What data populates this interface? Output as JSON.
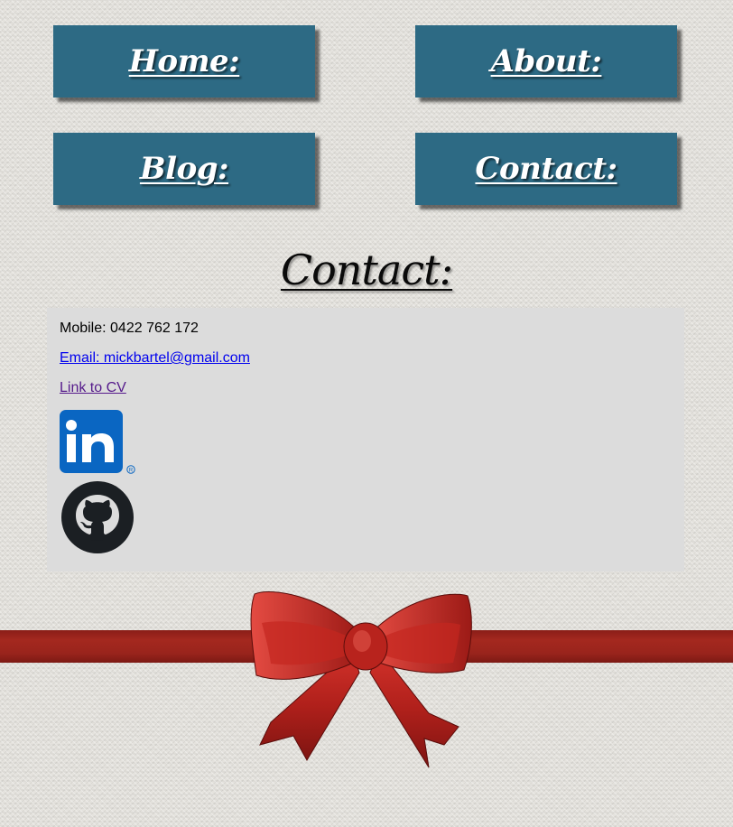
{
  "nav": {
    "home": "Home:",
    "about": "About:",
    "blog": "Blog:",
    "contact": "Contact:"
  },
  "page": {
    "title": "Contact:"
  },
  "contact": {
    "mobile": "Mobile: 0422 762 172",
    "email_link": "Email: mickbartel@gmail.com",
    "cv_link": "Link to CV"
  },
  "social": {
    "linkedin_icon": "linkedin-logo",
    "github_icon": "github-logo"
  },
  "colors": {
    "nav_button_bg": "#2d6a84",
    "nav_button_text": "#ffffff",
    "contact_box_bg": "#dcdcdc",
    "link_blue": "#0000ee",
    "link_visited": "#551a8b",
    "ribbon_red": "#9a241c",
    "linkedin_blue": "#0a66c2"
  }
}
